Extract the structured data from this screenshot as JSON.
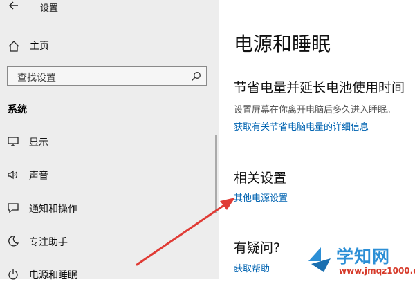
{
  "app": {
    "title": "设置"
  },
  "sidebar": {
    "home_label": "主页",
    "search_placeholder": "查找设置",
    "section_title": "系统",
    "items": [
      {
        "label": "显示",
        "icon": "monitor-icon"
      },
      {
        "label": "声音",
        "icon": "speaker-icon"
      },
      {
        "label": "通知和操作",
        "icon": "notification-icon"
      },
      {
        "label": "专注助手",
        "icon": "moon-icon"
      },
      {
        "label": "电源和睡眠",
        "icon": "power-icon"
      }
    ]
  },
  "main": {
    "page_title": "电源和睡眠",
    "battery_heading": "节省电量并延长电池使用时间",
    "battery_desc": "设置屏幕在你离开电脑后多久进入睡眠。",
    "battery_link": "获取有关节省电脑电量的详细信息",
    "related_heading": "相关设置",
    "related_link": "其他电源设置",
    "help_heading": "有疑问?",
    "help_link": "获取帮助"
  },
  "annotation": {
    "arrow_color": "#e03b35"
  },
  "watermark": {
    "text": "学知网",
    "url": "www.jmqz1000.com"
  },
  "colors": {
    "sidebar_bg": "#ededed",
    "link": "#0063b1"
  }
}
